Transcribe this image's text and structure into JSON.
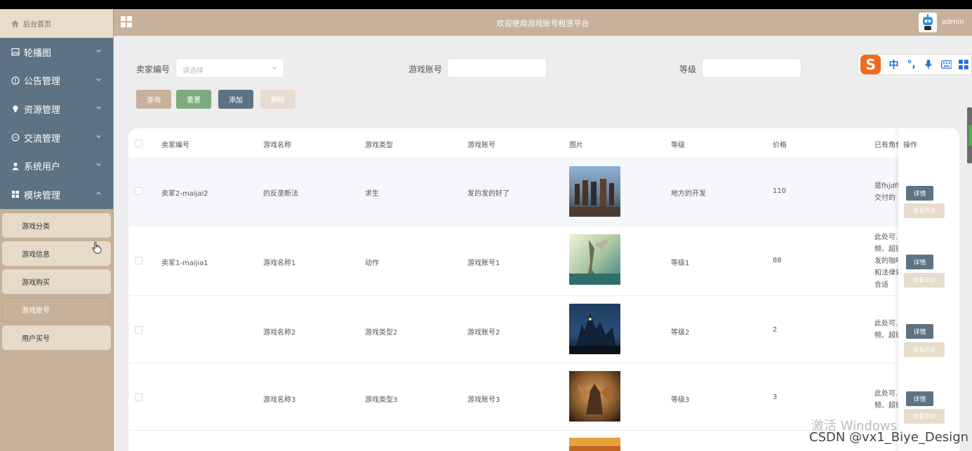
{
  "app": {
    "title": "欢迎使用游戏账号租赁平台",
    "user": "admin"
  },
  "sidebar": {
    "home": "后台首页",
    "menus": [
      {
        "label": "轮播图",
        "icon": "image-icon"
      },
      {
        "label": "公告管理",
        "icon": "info-circle-icon"
      },
      {
        "label": "资源管理",
        "icon": "bulb-icon"
      },
      {
        "label": "交流管理",
        "icon": "chat-icon"
      },
      {
        "label": "系统用户",
        "icon": "user-icon"
      },
      {
        "label": "模块管理",
        "icon": "grid-icon"
      }
    ],
    "submenu": [
      "游戏分类",
      "游戏信息",
      "游戏购买",
      "游戏账号",
      "用户买号"
    ],
    "active_submenu": "游戏账号"
  },
  "search": {
    "seller_label": "卖家编号",
    "seller_placeholder": "请选择",
    "account_label": "游戏账号",
    "account_value": "",
    "level_label": "等级",
    "level_value": "",
    "buttons": {
      "query": "查询",
      "reset": "重置",
      "add": "添加",
      "delete": "删除"
    }
  },
  "ime": {
    "lang": "中",
    "punct": "°,"
  },
  "table": {
    "headers": [
      "卖家编号",
      "游戏名称",
      "游戏类型",
      "游戏账号",
      "图片",
      "等级",
      "价格",
      "已有角色",
      "操作"
    ],
    "rows": [
      {
        "seller": "卖家2-maijai2",
        "name": "的反垄断法",
        "type": "求生",
        "account": "发的发的好了",
        "level": "地方的开发",
        "price": "110",
        "intro": [
          "是fhjdfk",
          "交付的"
        ]
      },
      {
        "seller": "卖家1-maijia1",
        "name": "游戏名称1",
        "type": "动作",
        "account": "游戏账号1",
        "level": "等级1",
        "price": "88",
        "intro": [
          "此处可...",
          "频、超链",
          "发的咖啡",
          "和法律效",
          "合适"
        ]
      },
      {
        "seller": "",
        "name": "游戏名称2",
        "type": "游戏类型2",
        "account": "游戏账号2",
        "level": "等级2",
        "price": "2",
        "intro": [
          "此处可...",
          "频、超链"
        ]
      },
      {
        "seller": "",
        "name": "游戏名称3",
        "type": "游戏类型3",
        "account": "游戏账号3",
        "level": "等级3",
        "price": "3",
        "intro": [
          "此处可...",
          "频、超链"
        ]
      }
    ],
    "op_detail": "详情",
    "op_comment": "查看评论"
  },
  "watermark": {
    "os": "激活 Windows",
    "credit": "CSDN @vx1_Biye_Design"
  },
  "colors": {
    "primary": "#c7b19a",
    "nav": "#5d7282",
    "reset": "#7dab7d"
  }
}
